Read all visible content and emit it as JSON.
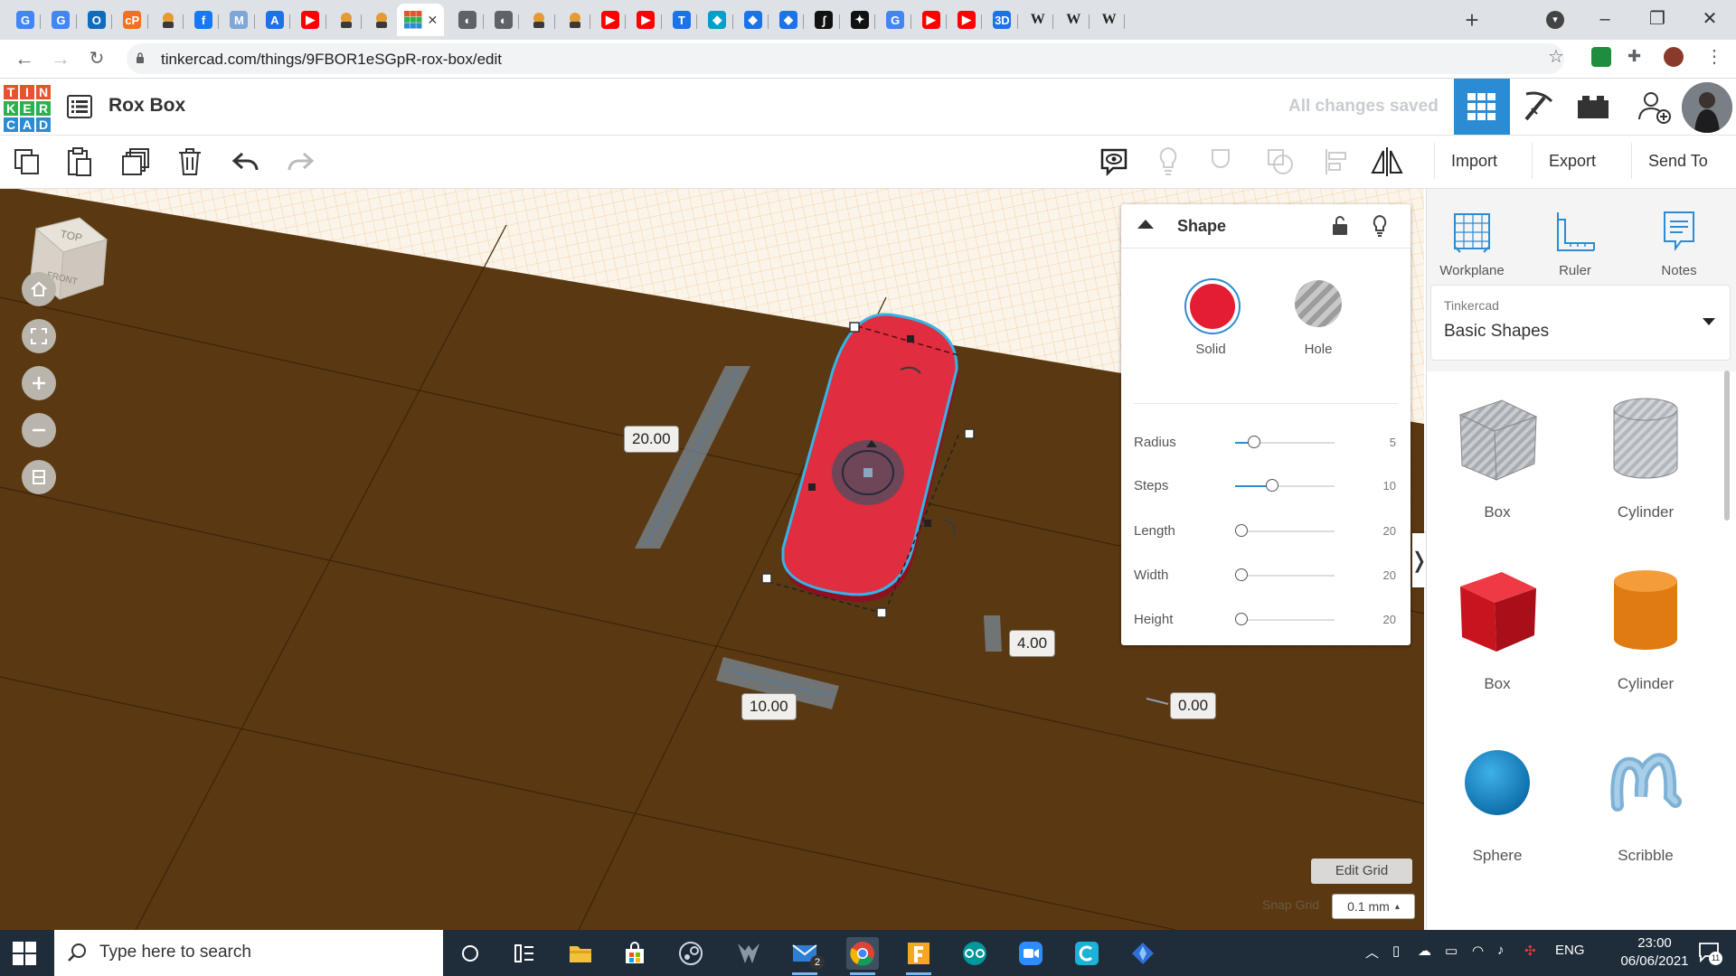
{
  "browser": {
    "tabs": [
      {
        "icon": "google-docs-icon",
        "color": "#4285f4",
        "glyph": "G"
      },
      {
        "icon": "google-docs-icon",
        "color": "#4285f4",
        "glyph": "G"
      },
      {
        "icon": "outlook-icon",
        "color": "#0f6cbd",
        "glyph": "O"
      },
      {
        "icon": "app-icon",
        "color": "#f37021",
        "glyph": "cP"
      },
      {
        "icon": "tinkercad-avatar-icon",
        "color": "#e59b2f",
        "glyph": ""
      },
      {
        "icon": "facebook-icon",
        "color": "#1877f2",
        "glyph": "f"
      },
      {
        "icon": "shield-icon",
        "color": "#7ea7d8",
        "glyph": "M"
      },
      {
        "icon": "app-icon",
        "color": "#1a73e8",
        "glyph": "A"
      },
      {
        "icon": "youtube-icon",
        "color": "#ff0000",
        "glyph": "▶"
      },
      {
        "icon": "tinkercad-avatar-icon",
        "color": "#e59b2f",
        "glyph": ""
      },
      {
        "icon": "tinkercad-avatar-icon",
        "color": "#e59b2f",
        "glyph": ""
      },
      {
        "icon": "tinkercad-logo-icon",
        "color": "#e6532d",
        "glyph": ""
      },
      {
        "icon": "globe-icon",
        "color": "#5f6368",
        "glyph": "◐"
      },
      {
        "icon": "globe-icon",
        "color": "#5f6368",
        "glyph": "◐"
      },
      {
        "icon": "tinkercad-avatar-icon",
        "color": "#e59b2f",
        "glyph": ""
      },
      {
        "icon": "tinkercad-avatar-icon",
        "color": "#e59b2f",
        "glyph": ""
      },
      {
        "icon": "youtube-icon",
        "color": "#ff0000",
        "glyph": "▶"
      },
      {
        "icon": "youtube-icon",
        "color": "#ff0000",
        "glyph": "▶"
      },
      {
        "icon": "app-icon",
        "color": "#1a73e8",
        "glyph": "T"
      },
      {
        "icon": "app-icon",
        "color": "#00a1c9",
        "glyph": "◆"
      },
      {
        "icon": "graduation-icon",
        "color": "#1a73e8",
        "glyph": "◆"
      },
      {
        "icon": "graduation-icon",
        "color": "#1a73e8",
        "glyph": "◆"
      },
      {
        "icon": "app-icon",
        "color": "#111111",
        "glyph": "∫"
      },
      {
        "icon": "app-icon",
        "color": "#111111",
        "glyph": "✦"
      },
      {
        "icon": "google-icon",
        "color": "#4285f4",
        "glyph": "G"
      },
      {
        "icon": "youtube-icon",
        "color": "#ff0000",
        "glyph": "▶"
      },
      {
        "icon": "youtube-icon",
        "color": "#ff0000",
        "glyph": "▶"
      },
      {
        "icon": "app-icon",
        "color": "#1a73e8",
        "glyph": "3D"
      },
      {
        "icon": "wikipedia-icon",
        "color": "#ffffff",
        "glyph": "W"
      },
      {
        "icon": "wikipedia-icon",
        "color": "#ffffff",
        "glyph": "W"
      },
      {
        "icon": "wikipedia-icon",
        "color": "#ffffff",
        "glyph": "W"
      }
    ],
    "url": "tinkercad.com/things/9FBOR1eSGpR-rox-box/edit"
  },
  "app": {
    "logo_letters": [
      "T",
      "I",
      "N",
      "K",
      "E",
      "R",
      "C",
      "A",
      "D"
    ],
    "logo_colors": [
      "#e6532d",
      "#e6532d",
      "#e6532d",
      "#2bb24c",
      "#2bb24c",
      "#2bb24c",
      "#2b8cd4",
      "#2b8cd4",
      "#2b8cd4"
    ],
    "design_title": "Rox Box",
    "save_status": "All changes saved",
    "accent": "#2b8cd4"
  },
  "toolbar": {
    "import_label": "Import",
    "export_label": "Export",
    "send_to_label": "Send To"
  },
  "viewcube": {
    "top": "TOP",
    "front": "FRONT"
  },
  "dimensions": {
    "d1": "20.00",
    "d2": "4.00",
    "d3": "10.00",
    "d4": "0.00"
  },
  "inspector": {
    "title": "Shape",
    "solid_label": "Solid",
    "hole_label": "Hole",
    "solid_color": "#e41d33",
    "props": [
      {
        "label": "Radius",
        "value": "5",
        "fraction": 0.19
      },
      {
        "label": "Steps",
        "value": "10",
        "fraction": 0.37
      },
      {
        "label": "Length",
        "value": "20",
        "fraction": 0.06
      },
      {
        "label": "Width",
        "value": "20",
        "fraction": 0.06
      },
      {
        "label": "Height",
        "value": "20",
        "fraction": 0.06
      }
    ]
  },
  "rightpanel": {
    "workplane_label": "Workplane",
    "ruler_label": "Ruler",
    "notes_label": "Notes",
    "library_category": "Tinkercad",
    "library_value": "Basic Shapes",
    "shapes": [
      {
        "label": "Box",
        "icon": "box-hole-icon"
      },
      {
        "label": "Cylinder",
        "icon": "cylinder-hole-icon"
      },
      {
        "label": "Box",
        "icon": "box-icon"
      },
      {
        "label": "Cylinder",
        "icon": "cylinder-icon"
      },
      {
        "label": "Sphere",
        "icon": "sphere-icon"
      },
      {
        "label": "Scribble",
        "icon": "scribble-icon"
      }
    ]
  },
  "grid": {
    "edit_grid_label": "Edit Grid",
    "snap_label": "Snap Grid",
    "snap_value": "0.1 mm"
  },
  "taskbar": {
    "search_placeholder": "Type here to search",
    "language": "ENG",
    "time": "23:00",
    "date": "06/06/2021",
    "mail_badge": "2",
    "notifications": "11"
  }
}
